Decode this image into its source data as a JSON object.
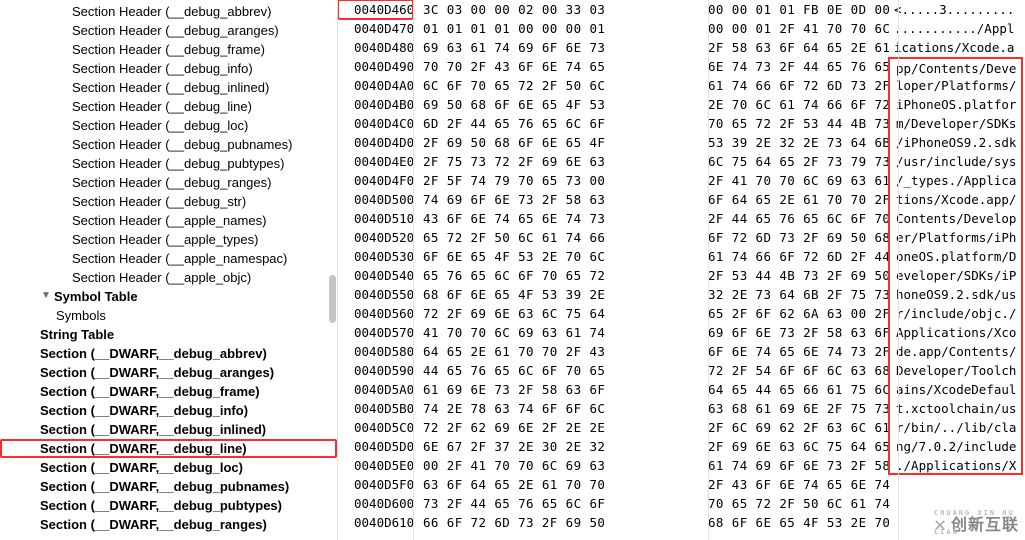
{
  "sidebar": [
    {
      "level": 3,
      "label": "Section Header (__debug_abbrev)",
      "interact": true
    },
    {
      "level": 3,
      "label": "Section Header (__debug_aranges)",
      "interact": true
    },
    {
      "level": 3,
      "label": "Section Header (__debug_frame)",
      "interact": true
    },
    {
      "level": 3,
      "label": "Section Header (__debug_info)",
      "interact": true
    },
    {
      "level": 3,
      "label": "Section Header (__debug_inlined)",
      "interact": true
    },
    {
      "level": 3,
      "label": "Section Header (__debug_line)",
      "interact": true
    },
    {
      "level": 3,
      "label": "Section Header (__debug_loc)",
      "interact": true
    },
    {
      "level": 3,
      "label": "Section Header (__debug_pubnames)",
      "interact": true
    },
    {
      "level": 3,
      "label": "Section Header (__debug_pubtypes)",
      "interact": true
    },
    {
      "level": 3,
      "label": "Section Header (__debug_ranges)",
      "interact": true
    },
    {
      "level": 3,
      "label": "Section Header (__debug_str)",
      "interact": true
    },
    {
      "level": 3,
      "label": "Section Header (__apple_names)",
      "interact": true
    },
    {
      "level": 3,
      "label": "Section Header (__apple_types)",
      "interact": true
    },
    {
      "level": 3,
      "label": "Section Header (__apple_namespac)",
      "interact": true
    },
    {
      "level": 3,
      "label": "Section Header (__apple_objc)",
      "interact": true
    },
    {
      "level": 1,
      "label": "Symbol Table",
      "interact": true,
      "twisty": "▼"
    },
    {
      "level": 2,
      "label": "Symbols",
      "interact": true
    },
    {
      "level": 1,
      "label": "String Table",
      "interact": true
    },
    {
      "level": 1,
      "label": "Section (__DWARF,__debug_abbrev)",
      "interact": true
    },
    {
      "level": 1,
      "label": "Section (__DWARF,__debug_aranges)",
      "interact": true
    },
    {
      "level": 1,
      "label": "Section (__DWARF,__debug_frame)",
      "interact": true
    },
    {
      "level": 1,
      "label": "Section (__DWARF,__debug_info)",
      "interact": true
    },
    {
      "level": 1,
      "label": "Section (__DWARF,__debug_inlined)",
      "interact": true
    },
    {
      "level": 1,
      "label": "Section (__DWARF,__debug_line)",
      "interact": true,
      "selected": true
    },
    {
      "level": 1,
      "label": "Section (__DWARF,__debug_loc)",
      "interact": true
    },
    {
      "level": 1,
      "label": "Section (__DWARF,__debug_pubnames)",
      "interact": true
    },
    {
      "level": 1,
      "label": "Section (__DWARF,__debug_pubtypes)",
      "interact": true
    },
    {
      "level": 1,
      "label": "Section (__DWARF,__debug_ranges)",
      "interact": true
    }
  ],
  "hex_rows": [
    {
      "addr": "0040D460",
      "addr_sel": true,
      "h1": "3C 03 00 00 02 00 33 03",
      "h2": "00 00 01 01 FB 0E 0D 00",
      "a": "<.....3........."
    },
    {
      "addr": "0040D470",
      "h1": "01 01 01 01 00 00 00 01",
      "h2": "00 00 01 2F 41 70 70 6C",
      "a": ".........../Appl"
    },
    {
      "addr": "0040D480",
      "h1": "69 63 61 74 69 6F 6E 73",
      "h2": "2F 58 63 6F 64 65 2E 61",
      "a": "ications/Xcode.a"
    },
    {
      "addr": "0040D490",
      "h1": "70 70 2F 43 6F 6E 74 65",
      "h2": "6E 74 73 2F 44 65 76 65",
      "a": "pp/Contents/Deve",
      "box": "top"
    },
    {
      "addr": "0040D4A0",
      "h1": "6C 6F 70 65 72 2F 50 6C",
      "h2": "61 74 66 6F 72 6D 73 2F",
      "a": "loper/Platforms/",
      "box": "mid"
    },
    {
      "addr": "0040D4B0",
      "h1": "69 50 68 6F 6E 65 4F 53",
      "h2": "2E 70 6C 61 74 66 6F 72",
      "a": "iPhoneOS.platfor",
      "box": "mid"
    },
    {
      "addr": "0040D4C0",
      "h1": "6D 2F 44 65 76 65 6C 6F",
      "h2": "70 65 72 2F 53 44 4B 73",
      "a": "m/Developer/SDKs",
      "box": "mid"
    },
    {
      "addr": "0040D4D0",
      "h1": "2F 69 50 68 6F 6E 65 4F",
      "h2": "53 39 2E 32 2E 73 64 6B",
      "a": "/iPhoneOS9.2.sdk",
      "box": "mid"
    },
    {
      "addr": "0040D4E0",
      "h1": "2F 75 73 72 2F 69 6E 63",
      "h2": "6C 75 64 65 2F 73 79 73",
      "a": "/usr/include/sys",
      "box": "mid"
    },
    {
      "addr": "0040D4F0",
      "h1": "2F 5F 74 79 70 65 73 00",
      "h2": "2F 41 70 70 6C 69 63 61",
      "a": "/_types./Applica",
      "box": "mid"
    },
    {
      "addr": "0040D500",
      "h1": "74 69 6F 6E 73 2F 58 63",
      "h2": "6F 64 65 2E 61 70 70 2F",
      "a": "tions/Xcode.app/",
      "box": "mid"
    },
    {
      "addr": "0040D510",
      "h1": "43 6F 6E 74 65 6E 74 73",
      "h2": "2F 44 65 76 65 6C 6F 70",
      "a": "Contents/Develop",
      "box": "mid"
    },
    {
      "addr": "0040D520",
      "h1": "65 72 2F 50 6C 61 74 66",
      "h2": "6F 72 6D 73 2F 69 50 68",
      "a": "er/Platforms/iPh",
      "box": "mid"
    },
    {
      "addr": "0040D530",
      "h1": "6F 6E 65 4F 53 2E 70 6C",
      "h2": "61 74 66 6F 72 6D 2F 44",
      "a": "oneOS.platform/D",
      "box": "mid"
    },
    {
      "addr": "0040D540",
      "h1": "65 76 65 6C 6F 70 65 72",
      "h2": "2F 53 44 4B 73 2F 69 50",
      "a": "eveloper/SDKs/iP",
      "box": "mid"
    },
    {
      "addr": "0040D550",
      "h1": "68 6F 6E 65 4F 53 39 2E",
      "h2": "32 2E 73 64 6B 2F 75 73",
      "a": "honeOS9.2.sdk/us",
      "box": "mid"
    },
    {
      "addr": "0040D560",
      "h1": "72 2F 69 6E 63 6C 75 64",
      "h2": "65 2F 6F 62 6A 63 00 2F",
      "a": "r/include/objc./",
      "box": "mid"
    },
    {
      "addr": "0040D570",
      "h1": "41 70 70 6C 69 63 61 74",
      "h2": "69 6F 6E 73 2F 58 63 6F",
      "a": "Applications/Xco",
      "box": "mid"
    },
    {
      "addr": "0040D580",
      "h1": "64 65 2E 61 70 70 2F 43",
      "h2": "6F 6E 74 65 6E 74 73 2F",
      "a": "de.app/Contents/",
      "box": "mid"
    },
    {
      "addr": "0040D590",
      "h1": "44 65 76 65 6C 6F 70 65",
      "h2": "72 2F 54 6F 6F 6C 63 68",
      "a": "Developer/Toolch",
      "box": "mid"
    },
    {
      "addr": "0040D5A0",
      "h1": "61 69 6E 73 2F 58 63 6F",
      "h2": "64 65 44 65 66 61 75 6C",
      "a": "ains/XcodeDefaul",
      "box": "mid"
    },
    {
      "addr": "0040D5B0",
      "h1": "74 2E 78 63 74 6F 6F 6C",
      "h2": "63 68 61 69 6E 2F 75 73",
      "a": "t.xctoolchain/us",
      "box": "mid"
    },
    {
      "addr": "0040D5C0",
      "h1": "72 2F 62 69 6E 2F 2E 2E",
      "h2": "2F 6C 69 62 2F 63 6C 61",
      "a": "r/bin/../lib/cla",
      "box": "mid"
    },
    {
      "addr": "0040D5D0",
      "h1": "6E 67 2F 37 2E 30 2E 32",
      "h2": "2F 69 6E 63 6C 75 64 65",
      "a": "ng/7.0.2/include",
      "box": "mid"
    },
    {
      "addr": "0040D5E0",
      "h1": "00 2F 41 70 70 6C 69 63",
      "h2": "61 74 69 6F 6E 73 2F 58",
      "a": "./Applications/X",
      "box": "bot"
    },
    {
      "addr": "0040D5F0",
      "h1": "63 6F 64 65 2E 61 70 70",
      "h2": "2F 43 6F 6E 74 65 6E 74",
      "a": ""
    },
    {
      "addr": "0040D600",
      "h1": "73 2F 44 65 76 65 6C 6F",
      "h2": "70 65 72 2F 50 6C 61 74",
      "a": ""
    },
    {
      "addr": "0040D610",
      "h1": "66 6F 72 6D 73 2F 69 50",
      "h2": "68 6F 6E 65 4F 53 2E 70",
      "a": ""
    }
  ],
  "watermark": {
    "text": "创新互联",
    "sub": "CHUANG XIN HU LIAN"
  }
}
